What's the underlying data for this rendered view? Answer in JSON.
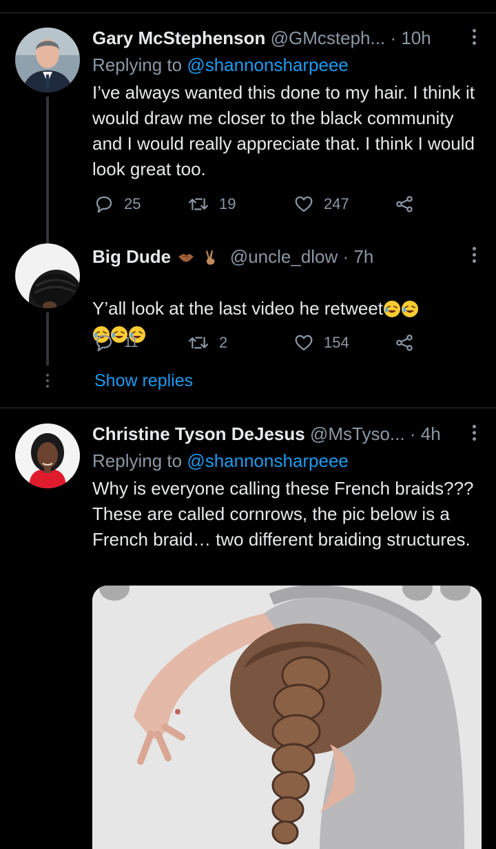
{
  "tweets": [
    {
      "name": "Gary McStephenson",
      "handle": "@GMcsteph...",
      "separator": "·",
      "time": "10h",
      "replying_label": "Replying to",
      "replying_to": "@shannonsharpeee",
      "text": "I’ve always wanted this done to my hair. I think it would draw me closer to the black community and I would really appreciate that. I think I would look great too.",
      "replies": "25",
      "retweets": "19",
      "likes": "247"
    },
    {
      "name": "Big Dude",
      "name_emojis": [
        "handshake-emoji",
        "victory-hand-emoji"
      ],
      "handle": "@uncle_dlow",
      "separator": "·",
      "time": "7h",
      "text": "Y’all look at the last video he retweet",
      "text_emojis": [
        "rofl-emoji",
        "rofl-emoji",
        "rofl-emoji",
        "rofl-emoji",
        "rofl-emoji"
      ],
      "replies": "11",
      "retweets": "2",
      "likes": "154",
      "show_replies": "Show replies"
    },
    {
      "name": "Christine Tyson DeJesus",
      "handle": "@MsTyso...",
      "separator": "·",
      "time": "4h",
      "replying_label": "Replying to",
      "replying_to": "@shannonsharpeee",
      "text": "Why is everyone calling these French braids??? These are called cornrows, the pic below is a French braid… two different braiding structures.",
      "image": "french-braid-photo"
    }
  ],
  "colors": {
    "background": "#000000",
    "text": "#e7e9ea",
    "muted": "#8b98a5",
    "accent": "#1d9bf0",
    "divider": "#2f3336"
  }
}
